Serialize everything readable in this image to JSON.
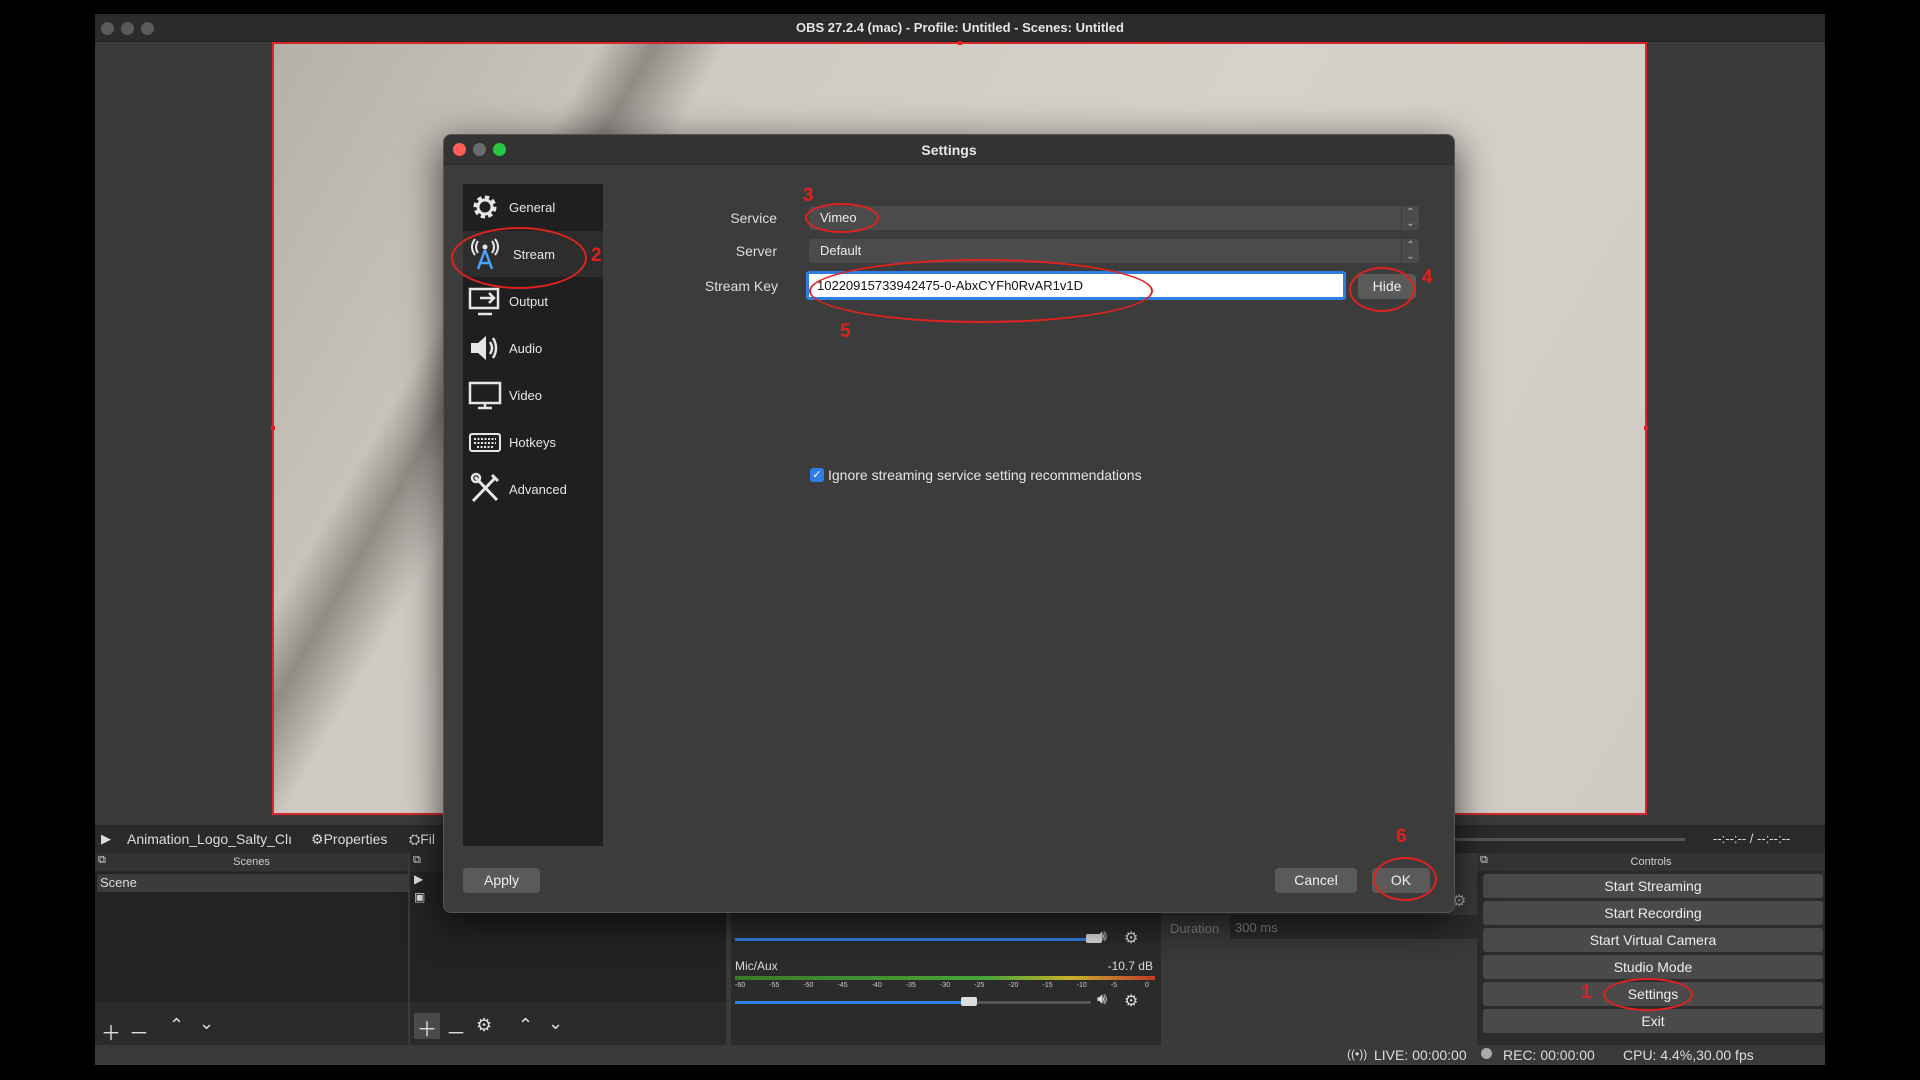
{
  "window": {
    "title": "OBS 27.2.4 (mac) - Profile: Untitled - Scenes: Untitled"
  },
  "source_bar": {
    "play_icon": "play-icon",
    "source_name": "Animation_Logo_Salty_Clı",
    "properties_label": "Properties",
    "filters_label": "Fil",
    "time_display": "--:--:-- / --:--:--"
  },
  "scenes_dock": {
    "title": "Scenes",
    "items": [
      "Scene"
    ]
  },
  "controls_dock": {
    "title": "Controls",
    "buttons": [
      "Start Streaming",
      "Start Recording",
      "Start Virtual Camera",
      "Studio Mode",
      "Settings",
      "Exit"
    ]
  },
  "transition_dock": {
    "duration_label": "Duration",
    "duration_value": "300 ms"
  },
  "mixer": {
    "channel_name": "Mic/Aux",
    "channel_level": "-10.7 dB",
    "scale": [
      "-60",
      "-55",
      "-50",
      "-45",
      "-40",
      "-35",
      "-30",
      "-25",
      "-20",
      "-15",
      "-10",
      "-5",
      "0"
    ]
  },
  "status_bar": {
    "live": "LIVE: 00:00:00",
    "rec": "REC: 00:00:00",
    "cpu": "CPU: 4.4%,30.00 fps"
  },
  "settings": {
    "title": "Settings",
    "nav": [
      {
        "label": "General",
        "icon": "gear-icon"
      },
      {
        "label": "Stream",
        "icon": "broadcast-antenna-icon"
      },
      {
        "label": "Output",
        "icon": "output-icon"
      },
      {
        "label": "Audio",
        "icon": "speaker-icon"
      },
      {
        "label": "Video",
        "icon": "monitor-icon"
      },
      {
        "label": "Hotkeys",
        "icon": "keyboard-icon"
      },
      {
        "label": "Advanced",
        "icon": "tools-icon"
      }
    ],
    "active_nav": "Stream",
    "service_label": "Service",
    "service_value": "Vimeo",
    "server_label": "Server",
    "server_value": "Default",
    "stream_key_label": "Stream Key",
    "stream_key_value": "10220915733942475-0-AbxCYFh0RvAR1v1D",
    "hide_button": "Hide",
    "ignore_checkbox_label": "Ignore streaming service setting recommendations",
    "ignore_checked": true,
    "apply_button": "Apply",
    "cancel_button": "Cancel",
    "ok_button": "OK"
  },
  "annotations": {
    "step1": "1",
    "step2": "2",
    "step3": "3",
    "step4": "4",
    "step5": "5",
    "step6": "6",
    "color": "#e0221f"
  },
  "colors": {
    "accent": "#2f7ee6",
    "close": "#ff5f57",
    "minimize": "#6b6b6b",
    "zoom": "#28c840",
    "preview_border": "#d8282c"
  }
}
